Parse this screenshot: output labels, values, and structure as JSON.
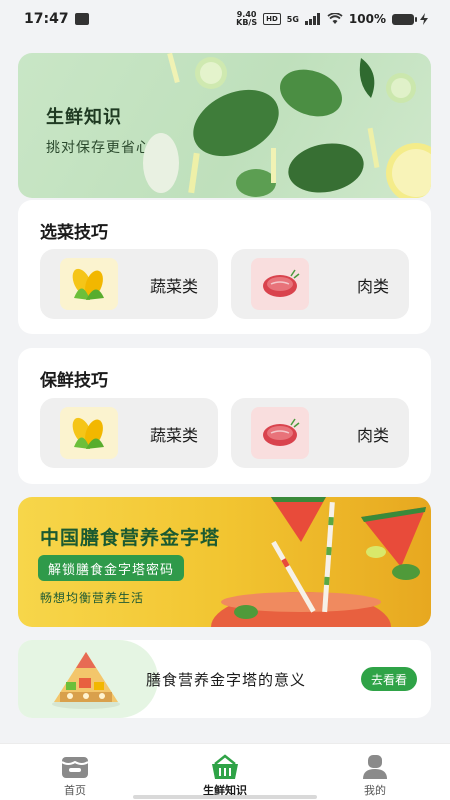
{
  "status_bar": {
    "time": "17:47",
    "net_speed_top": "9.40",
    "net_speed_unit": "KB/S",
    "hd": "HD",
    "network": "5G",
    "battery": "100%"
  },
  "hero": {
    "title": "生鲜知识",
    "subtitle": "挑对保存更省心"
  },
  "select_tips": {
    "title": "选菜技巧",
    "items": [
      {
        "label": "蔬菜类",
        "icon": "corn-icon"
      },
      {
        "label": "肉类",
        "icon": "steak-icon"
      }
    ]
  },
  "fresh_tips": {
    "title": "保鲜技巧",
    "items": [
      {
        "label": "蔬菜类",
        "icon": "corn-icon"
      },
      {
        "label": "肉类",
        "icon": "steak-icon"
      }
    ]
  },
  "promo": {
    "title": "中国膳食营养金字塔",
    "button": "解锁膳食金字塔密码",
    "subtitle": "畅想均衡营养生活"
  },
  "meaning": {
    "text": "膳食营养金字塔的意义",
    "button": "去看看"
  },
  "bottom_nav": {
    "items": [
      {
        "label": "首页",
        "icon": "home-icon",
        "active": false
      },
      {
        "label": "生鲜知识",
        "icon": "basket-icon",
        "active": true
      },
      {
        "label": "我的",
        "icon": "profile-icon",
        "active": false
      }
    ]
  },
  "colors": {
    "accent_green": "#2fa347",
    "page_bg": "#f2f3f5",
    "tile_bg": "#efefef"
  }
}
